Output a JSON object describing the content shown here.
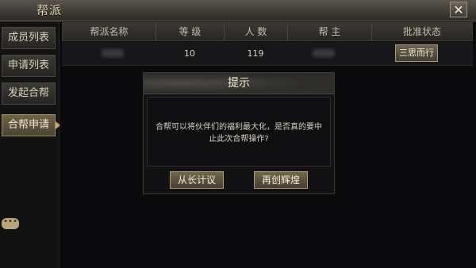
{
  "window": {
    "title": "帮派"
  },
  "sidebar": {
    "items": [
      {
        "label": "成员列表"
      },
      {
        "label": "申请列表"
      },
      {
        "label": "发起合帮"
      },
      {
        "label": "合帮申请"
      }
    ]
  },
  "table": {
    "headers": [
      "帮派名称",
      "等 级",
      "人 数",
      "帮 主",
      "批准状态"
    ],
    "rows": [
      {
        "name": "",
        "level": "10",
        "members": "119",
        "leader": "",
        "status": "三思而行"
      }
    ]
  },
  "dialog": {
    "title": "提示",
    "message": "合帮可以将伙伴们的福利最大化，是否真的要中止此次合帮操作?",
    "cancel_label": "从长计议",
    "confirm_label": "再创辉煌"
  },
  "colors": {
    "accent": "#a08c5a",
    "text": "#d8d0bd"
  }
}
